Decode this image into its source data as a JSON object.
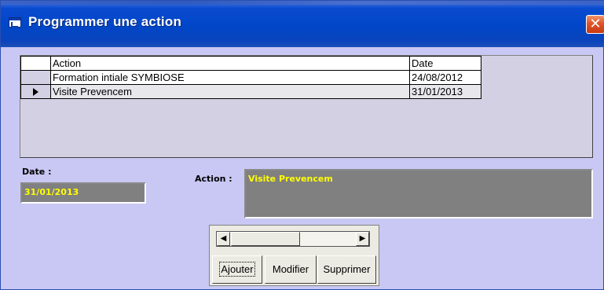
{
  "window": {
    "title": "Programmer une action",
    "close_glyph": "✕",
    "title_icon": "window-icon",
    "accent_color": "#0046c8",
    "body_color": "#c9c8f4"
  },
  "grid": {
    "columns": [
      "Action",
      "Date"
    ],
    "rows": [
      {
        "action": "Formation intiale SYMBIOSE",
        "date": "24/08/2012",
        "current": false
      },
      {
        "action": "Visite Prevencem",
        "date": "31/01/2013",
        "current": true
      }
    ]
  },
  "form": {
    "date_label": "Date :",
    "date_value": "31/01/2013",
    "action_label": "Action :",
    "action_value": "Visite Prevencem",
    "field_bg": "#808080",
    "field_text_color": "#ffff00"
  },
  "scrollbar": {
    "left_glyph": "◀",
    "right_glyph": "▶"
  },
  "buttons": {
    "add": "Ajouter",
    "edit": "Modifier",
    "delete": "Supprimer"
  }
}
